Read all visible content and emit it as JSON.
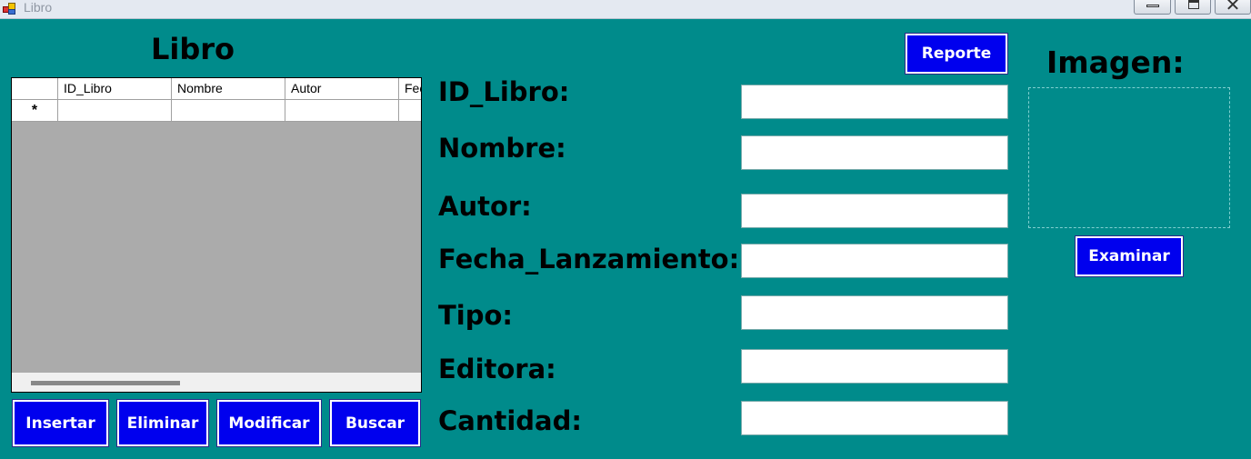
{
  "window": {
    "title": "Libro"
  },
  "grid_section": {
    "title": "Libro",
    "columns": [
      "ID_Libro",
      "Nombre",
      "Autor",
      "Fecha_Lanzamiento"
    ],
    "new_row_marker": "*"
  },
  "actions": {
    "insertar": "Insertar",
    "eliminar": "Eliminar",
    "modificar": "Modificar",
    "buscar": "Buscar",
    "reporte": "Reporte"
  },
  "form": {
    "fields": [
      {
        "label": "ID_Libro:",
        "value": ""
      },
      {
        "label": "Nombre:",
        "value": ""
      },
      {
        "label": "Autor:",
        "value": ""
      },
      {
        "label": "Fecha_Lanzamiento:",
        "value": ""
      },
      {
        "label": "Tipo:",
        "value": ""
      },
      {
        "label": "Editora:",
        "value": ""
      },
      {
        "label": "Cantidad:",
        "value": ""
      }
    ]
  },
  "image_section": {
    "title": "Imagen:",
    "browse_label": "Examinar"
  },
  "colors": {
    "background": "#008B8B",
    "button": "#0000EE",
    "grid_empty_area": "#ABABAB"
  },
  "icons": {
    "app": "app-window-icon",
    "minimize": "minimize-icon",
    "maximize": "maximize-icon",
    "close": "close-icon"
  }
}
